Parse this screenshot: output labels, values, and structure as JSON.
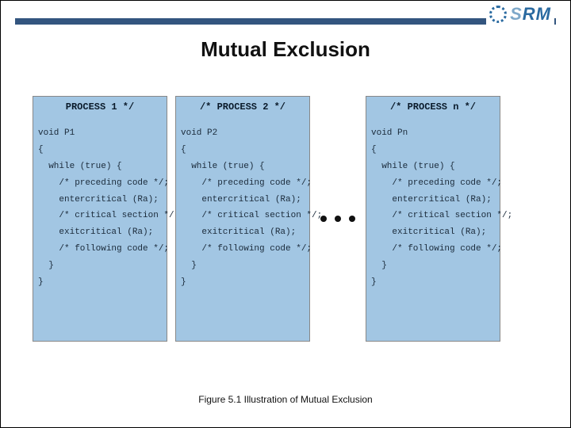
{
  "logo": {
    "text_light": "S",
    "text_dark": "RM"
  },
  "title": "Mutual Exclusion",
  "panels": [
    {
      "header": "PROCESS 1 */",
      "code": "void P1\n{\n  while (true) {\n    /* preceding code */;\n    entercritical (Ra);\n    /* critical section */;\n    exitcritical (Ra);\n    /* following code */;\n  }\n}"
    },
    {
      "header": "/* PROCESS 2 */",
      "code": "void P2\n{\n  while (true) {\n    /* preceding code */;\n    entercritical (Ra);\n    /* critical section */;\n    exitcritical (Ra);\n    /* following code */;\n  }\n}"
    },
    {
      "header": "/* PROCESS n */",
      "code": "void Pn\n{\n  while (true) {\n    /* preceding code */;\n    entercritical (Ra);\n    /* critical section */;\n    exitcritical (Ra);\n    /* following code */;\n  }\n}"
    }
  ],
  "caption": "Figure 5.1    Illustration of Mutual Exclusion"
}
